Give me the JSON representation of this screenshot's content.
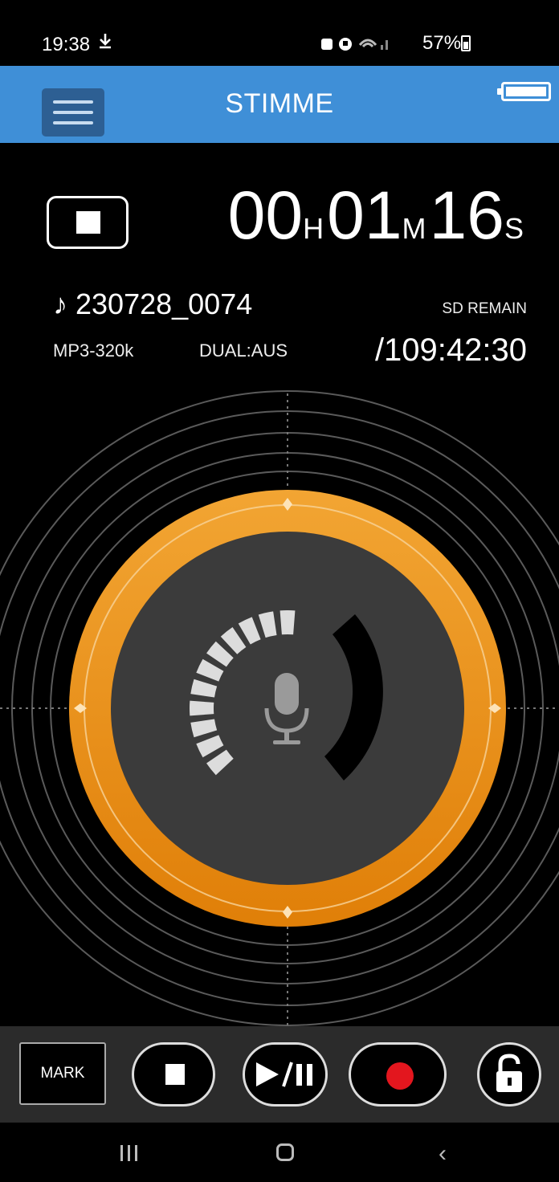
{
  "status_bar": {
    "time": "19:38",
    "download_icon": "ล",
    "icons": "◙ ⏰ ◠ .❘",
    "battery": "57%"
  },
  "header": {
    "title": "STIMME"
  },
  "recording": {
    "hours": "00",
    "hours_unit": "H",
    "minutes": "01",
    "minutes_unit": "M",
    "seconds": "16",
    "seconds_unit": "S",
    "file_name": "♪ 230728_0074",
    "format": "MP3-320k",
    "dual": "DUAL:AUS",
    "sd_label": "SD REMAIN",
    "sd_remaining": "/109:42:30"
  },
  "level_meter": {
    "level": 0.52,
    "segments_total": 21,
    "accent_color": "#f0a02a",
    "accent_dark": "#e07f08"
  },
  "controls": {
    "mark_label": "MARK"
  },
  "colors": {
    "appbar": "#3f8fd7",
    "record_red": "#e3161e"
  }
}
